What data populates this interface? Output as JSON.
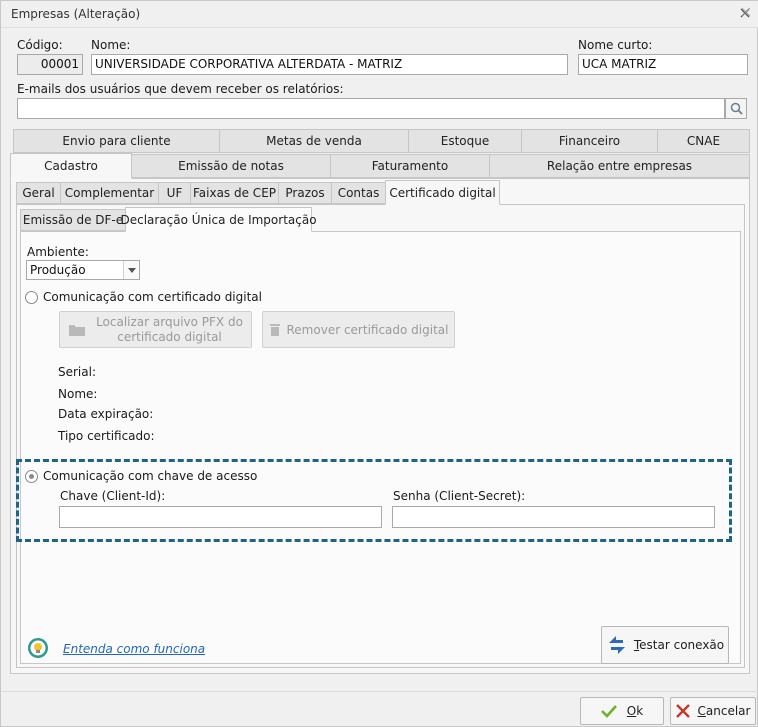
{
  "window": {
    "title": "Empresas (Alteração)"
  },
  "fields": {
    "codigo_label": "Código:",
    "codigo_value": "00001",
    "nome_label": "Nome:",
    "nome_value": "UNIVERSIDADE CORPORATIVA ALTERDATA - MATRIZ",
    "nome_curto_label": "Nome curto:",
    "nome_curto_value": "UCA MATRIZ",
    "emails_label": "E-mails dos usuários que devem receber os relatórios:",
    "emails_value": ""
  },
  "tabs_row1": [
    "Envio para cliente",
    "Metas de venda",
    "Estoque",
    "Financeiro",
    "CNAE"
  ],
  "tabs_row2": [
    "Cadastro",
    "Emissão de notas",
    "Faturamento",
    "Relação entre empresas"
  ],
  "tabs_row3": [
    "Geral",
    "Complementar",
    "UF",
    "Faixas de CEP",
    "Prazos",
    "Contas",
    "Certificado digital"
  ],
  "tabs_row4": [
    "Emissão de DF-e",
    "Declaração Única de Importação"
  ],
  "content": {
    "ambiente_label": "Ambiente:",
    "ambiente_value": "Produção",
    "radio_certificado": "Comunicação com certificado digital",
    "btn_localizar_line1": "Localizar arquivo PFX do",
    "btn_localizar_line2": "certificado digital",
    "btn_remover": "Remover certificado digital",
    "serial_label": "Serial:",
    "nome_label": "Nome:",
    "data_expiracao_label": "Data expiração:",
    "tipo_certificado_label": "Tipo certificado:",
    "radio_chave": "Comunicação com chave de acesso",
    "chave_label": "Chave (Client-Id):",
    "chave_value": "",
    "senha_label": "Senha (Client-Secret):",
    "senha_value": "",
    "link_text": "Entenda como funciona",
    "btn_testar_first": "T",
    "btn_testar_rest": "estar conexão"
  },
  "footer": {
    "ok_first": "O",
    "ok_rest": "k",
    "cancel_first": "C",
    "cancel_rest": "ancelar"
  },
  "colors": {
    "dashed_border": "#1e6585",
    "link": "#2468b4",
    "ok_check": "#6ab42c",
    "cancel_x": "#c0392b"
  }
}
